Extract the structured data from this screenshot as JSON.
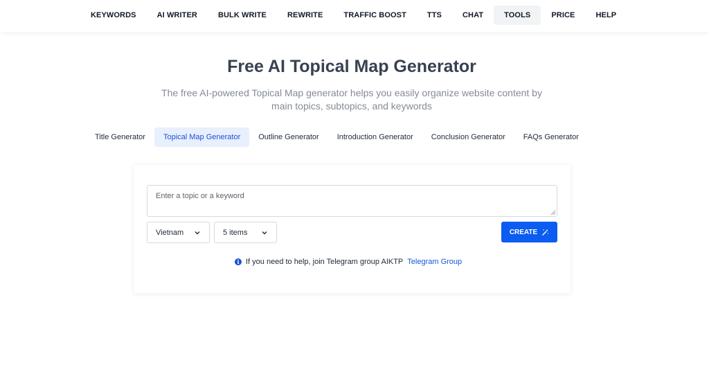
{
  "nav": {
    "items": [
      {
        "label": "KEYWORDS"
      },
      {
        "label": "AI WRITER"
      },
      {
        "label": "BULK WRITE"
      },
      {
        "label": "REWRITE"
      },
      {
        "label": "TRAFFIC BOOST"
      },
      {
        "label": "TTS"
      },
      {
        "label": "CHAT"
      },
      {
        "label": "TOOLS"
      },
      {
        "label": "PRICE"
      },
      {
        "label": "HELP"
      }
    ],
    "active": "TOOLS"
  },
  "header": {
    "title": "Free AI Topical Map Generator",
    "subtitle": "The free AI-powered Topical Map generator helps you easily organize website content by main topics, subtopics, and keywords"
  },
  "tool_tabs": {
    "items": [
      {
        "label": "Title Generator"
      },
      {
        "label": "Topical Map Generator"
      },
      {
        "label": "Outline Generator"
      },
      {
        "label": "Introduction Generator"
      },
      {
        "label": "Conclusion Generator"
      },
      {
        "label": "FAQs Generator"
      }
    ],
    "active": "Topical Map Generator"
  },
  "form": {
    "topic_input": {
      "placeholder": "Enter a topic or a keyword",
      "value": ""
    },
    "language_select": {
      "selected": "Vietnam"
    },
    "items_select": {
      "selected": "5 items"
    },
    "create_button": {
      "label": "CREATE",
      "icon": "magic-wand-icon"
    },
    "help": {
      "icon": "info-icon",
      "text": "If you need to help, join Telegram group AIKTP",
      "link_text": "Telegram Group"
    }
  },
  "colors": {
    "accent": "#0b5cf0",
    "active_tab_bg": "#e8f0fe",
    "active_tab_text": "#1d4ed8",
    "nav_active_bg": "#f1f3f5",
    "title": "#374151",
    "subtitle": "#858b94"
  }
}
